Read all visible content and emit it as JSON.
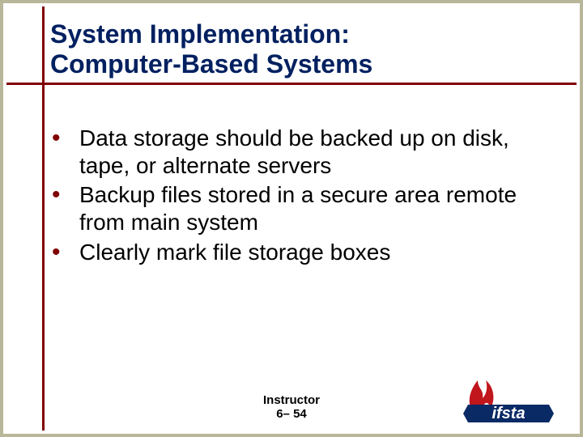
{
  "title": "System Implementation:\nComputer-Based Systems",
  "bullets": [
    "Data storage should be backed up on disk, tape, or alternate servers",
    "Backup files stored in a secure area remote from main system",
    "Clearly mark file storage boxes"
  ],
  "footer": "Instructor\n6– 54",
  "colors": {
    "accent": "#800000",
    "title": "#002060",
    "border": "#b9b799"
  }
}
